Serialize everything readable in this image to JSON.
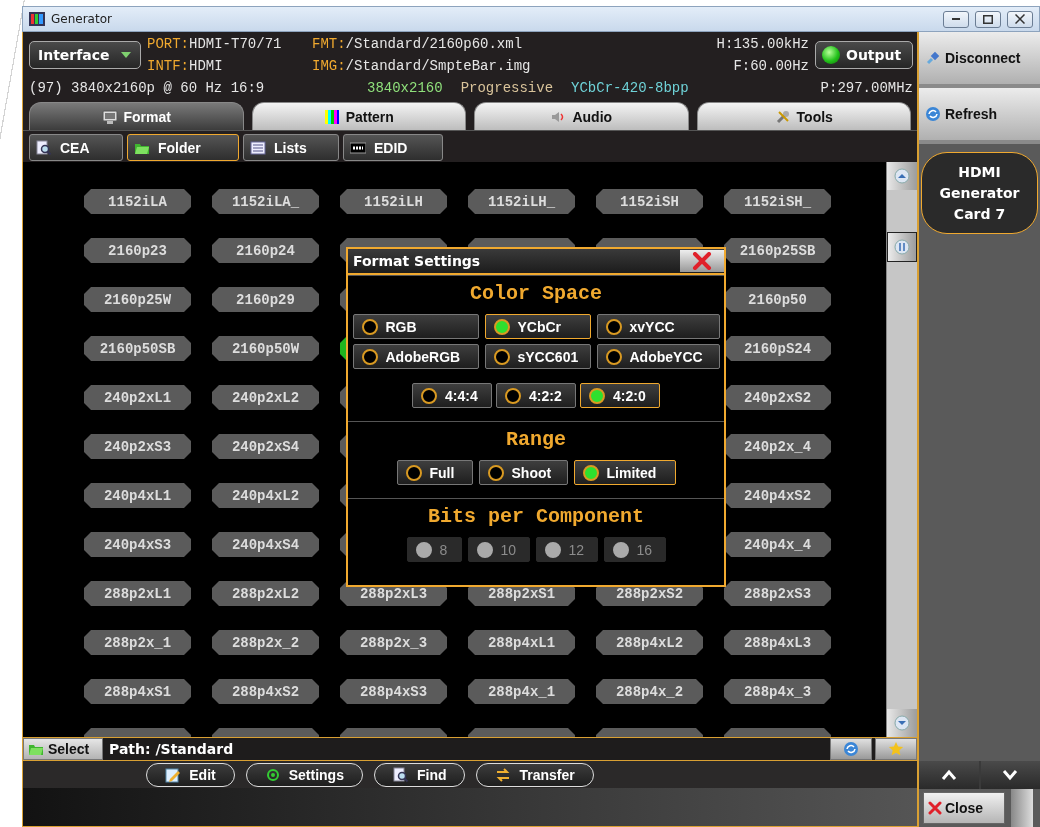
{
  "window": {
    "title": "Generator"
  },
  "interface_button": {
    "label": "Interface"
  },
  "info_fields": [
    {
      "key": "PORT:",
      "value": "HDMI-T70/71"
    },
    {
      "key": "INTF:",
      "value": "HDMI"
    },
    {
      "key": "FMT:",
      "value": "/Standard/2160p60.xml"
    },
    {
      "key": "IMG:",
      "value": "/Standard/SmpteBar.img"
    }
  ],
  "frequencies": [
    "H:135.00kHz",
    "F:60.00Hz"
  ],
  "output_button": {
    "label": "Output",
    "on": true
  },
  "signal_line": {
    "summary": "(97) 3840x2160p @ 60 Hz 16:9",
    "parts": [
      {
        "kind": "resolution",
        "text": "3840x2160"
      },
      {
        "kind": "scan",
        "text": "Progressive"
      },
      {
        "kind": "encoding",
        "text": "YCbCr-420-8bpp"
      }
    ],
    "pixel_clock": "P:297.00MHz"
  },
  "tabs": [
    {
      "label": "Format",
      "selected": true
    },
    {
      "label": "Pattern",
      "selected": false
    },
    {
      "label": "Audio",
      "selected": false
    },
    {
      "label": "Tools",
      "selected": false
    }
  ],
  "subtabs": [
    {
      "label": "CEA",
      "selected": false
    },
    {
      "label": "Folder",
      "selected": true
    },
    {
      "label": "Lists",
      "selected": false
    },
    {
      "label": "EDID",
      "selected": false
    }
  ],
  "format_grid": {
    "rows": [
      [
        {
          "label": "1152iLA",
          "selected": false
        },
        {
          "label": "1152iLA_",
          "selected": false
        },
        {
          "label": "1152iLH",
          "selected": false
        },
        {
          "label": "1152iLH_",
          "selected": false
        },
        {
          "label": "1152iSH",
          "selected": false
        },
        {
          "label": "1152iSH_",
          "selected": false
        }
      ],
      [
        {
          "label": "2160p23",
          "selected": false
        },
        {
          "label": "2160p24",
          "selected": false
        },
        {
          "selected": false
        },
        {
          "selected": false
        },
        {
          "selected": false
        },
        {
          "label": "2160p25SB",
          "selected": false
        }
      ],
      [
        {
          "label": "2160p25W",
          "selected": false
        },
        {
          "label": "2160p29",
          "selected": false
        },
        {
          "selected": false
        },
        null,
        null,
        {
          "label": "2160p50",
          "selected": false
        }
      ],
      [
        {
          "label": "2160p50SB",
          "selected": false
        },
        {
          "label": "2160p50W",
          "selected": false
        },
        {
          "selected": true
        },
        null,
        null,
        {
          "label": "2160pS24",
          "selected": false
        }
      ],
      [
        {
          "label": "240p2xL1",
          "selected": false
        },
        {
          "label": "240p2xL2",
          "selected": false
        },
        {
          "selected": false
        },
        null,
        null,
        {
          "label": "240p2xS2",
          "selected": false
        }
      ],
      [
        {
          "label": "240p2xS3",
          "selected": false
        },
        {
          "label": "240p2xS4",
          "selected": false
        },
        {
          "selected": false
        },
        null,
        null,
        {
          "label": "240p2x_4",
          "selected": false
        }
      ],
      [
        {
          "label": "240p4xL1",
          "selected": false
        },
        {
          "label": "240p4xL2",
          "selected": false
        },
        {
          "selected": false
        },
        null,
        null,
        {
          "label": "240p4xS2",
          "selected": false
        }
      ],
      [
        {
          "label": "240p4xS3",
          "selected": false
        },
        {
          "label": "240p4xS4",
          "selected": false
        },
        {
          "selected": false
        },
        null,
        null,
        {
          "label": "240p4x_4",
          "selected": false
        }
      ],
      [
        {
          "label": "288p2xL1",
          "selected": false
        },
        {
          "label": "288p2xL2",
          "selected": false
        },
        {
          "label": "288p2xL3",
          "selected": false
        },
        {
          "label": "288p2xS1",
          "selected": false
        },
        {
          "label": "288p2xS2",
          "selected": false
        },
        {
          "label": "288p2xS3",
          "selected": false
        }
      ],
      [
        {
          "label": "288p2x_1",
          "selected": false
        },
        {
          "label": "288p2x_2",
          "selected": false
        },
        {
          "label": "288p2x_3",
          "selected": false
        },
        {
          "label": "288p4xL1",
          "selected": false
        },
        {
          "label": "288p4xL2",
          "selected": false
        },
        {
          "label": "288p4xL3",
          "selected": false
        }
      ],
      [
        {
          "label": "288p4xS1",
          "selected": false
        },
        {
          "label": "288p4xS2",
          "selected": false
        },
        {
          "label": "288p4xS3",
          "selected": false
        },
        {
          "label": "288p4x_1",
          "selected": false
        },
        {
          "label": "288p4x_2",
          "selected": false
        },
        {
          "label": "288p4x_3",
          "selected": false
        }
      ],
      [
        {
          "selected": false
        },
        {
          "selected": false
        },
        {
          "selected": false
        },
        {
          "selected": false
        },
        {
          "selected": false
        },
        {
          "selected": false
        }
      ]
    ]
  },
  "status_bar": {
    "select_button": "Select",
    "path": "Path: /Standard"
  },
  "actions": [
    {
      "label": "Edit"
    },
    {
      "label": "Settings"
    },
    {
      "label": "Find"
    },
    {
      "label": "Transfer"
    }
  ],
  "sidebar": {
    "buttons": [
      {
        "label": "Disconnect"
      },
      {
        "label": "Refresh"
      }
    ],
    "card": "HDMI Generator Card 7",
    "close_button": "Close"
  },
  "dialog": {
    "title": "Format Settings",
    "sections": [
      {
        "heading": "Color Space",
        "disabled": false,
        "groups": [
          [
            {
              "label": "RGB",
              "selected": false
            },
            {
              "label": "YCbCr",
              "selected": true
            },
            {
              "label": "xvYCC",
              "selected": false
            }
          ],
          [
            {
              "label": "AdobeRGB",
              "selected": false
            },
            {
              "label": "sYCC601",
              "selected": false
            },
            {
              "label": "AdobeYCC",
              "selected": false
            }
          ],
          [
            {
              "label": "4:4:4",
              "selected": false
            },
            {
              "label": "4:2:2",
              "selected": false
            },
            {
              "label": "4:2:0",
              "selected": true
            }
          ]
        ]
      },
      {
        "heading": "Range",
        "disabled": false,
        "groups": [
          [
            {
              "label": "Full",
              "selected": false
            },
            {
              "label": "Shoot",
              "selected": false
            },
            {
              "label": "Limited",
              "selected": true
            }
          ]
        ]
      },
      {
        "heading": "Bits per Component",
        "disabled": true,
        "groups": [
          [
            {
              "label": "8",
              "selected": false
            },
            {
              "label": "10",
              "selected": false
            },
            {
              "label": "12",
              "selected": false
            },
            {
              "label": "16",
              "selected": false
            }
          ]
        ]
      }
    ]
  }
}
